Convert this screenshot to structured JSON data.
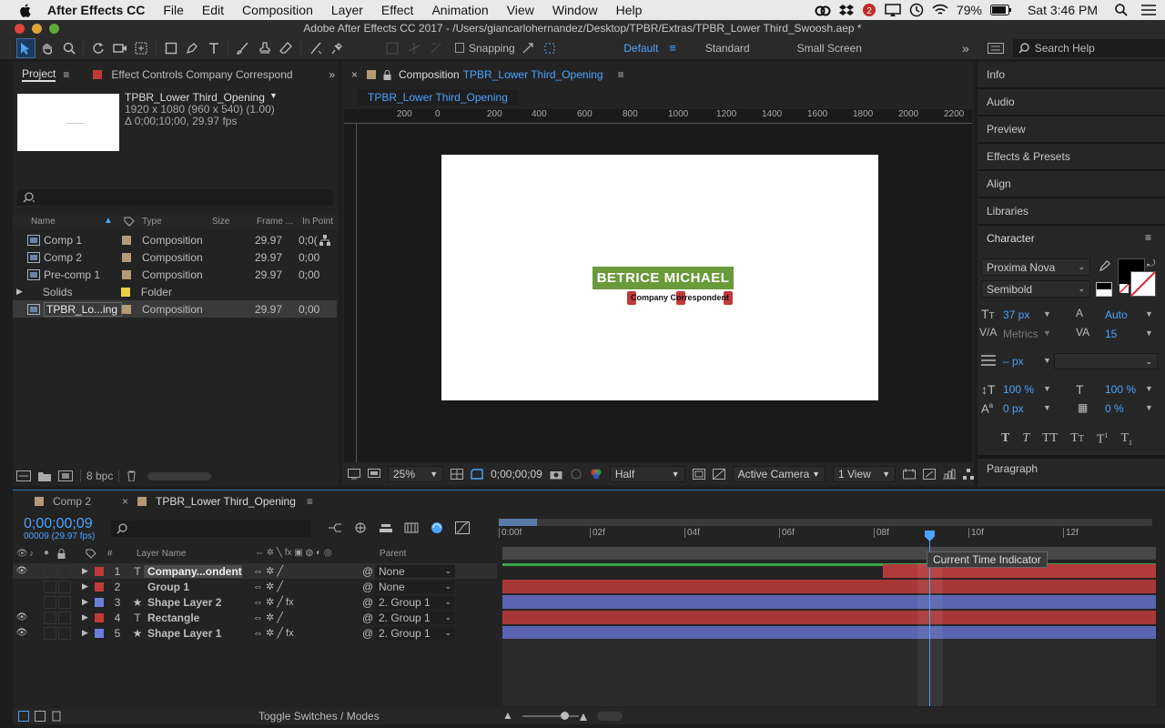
{
  "menubar": {
    "app": "After Effects CC",
    "items": [
      "File",
      "Edit",
      "Composition",
      "Layer",
      "Effect",
      "Animation",
      "View",
      "Window",
      "Help"
    ],
    "battery": "79%",
    "clock": "Sat 3:46 PM"
  },
  "window": {
    "title": "Adobe After Effects CC 2017 - /Users/giancarlohernandez/Desktop/TPBR/Extras/TPBR_Lower Third_Swoosh.aep *"
  },
  "toolbar": {
    "snapping_label": "Snapping",
    "workspaces": [
      "Default",
      "Standard",
      "Small Screen"
    ],
    "active_workspace": "Default",
    "search_help_placeholder": "Search Help"
  },
  "project_panel": {
    "tab_project": "Project",
    "tab_effect_controls": "Effect Controls Company Correspond",
    "selected_item_name": "TPBR_Lower Third_Opening",
    "selected_item_dims": "1920 x 1080  (960 x 540) (1.00)",
    "selected_item_duration": "Δ 0;00;10;00, 29.97 fps",
    "columns": [
      "Name",
      "Type",
      "Size",
      "Frame ...",
      "In Point"
    ],
    "rows": [
      {
        "name": "Comp 1",
        "label_color": "#b49a78",
        "type": "Composition",
        "size": "",
        "frame": "29.97",
        "in_point": "0;0("
      },
      {
        "name": "Comp 2",
        "label_color": "#b49a78",
        "type": "Composition",
        "size": "",
        "frame": "29.97",
        "in_point": "0;00"
      },
      {
        "name": "Pre-comp 1",
        "label_color": "#b49a78",
        "type": "Composition",
        "size": "",
        "frame": "29.97",
        "in_point": "0;00"
      },
      {
        "name": "Solids",
        "label_color": "#e8d244",
        "type": "Folder",
        "size": "",
        "frame": "",
        "in_point": ""
      },
      {
        "name": "TPBR_Lo...ing",
        "label_color": "#b49a78",
        "type": "Composition",
        "size": "",
        "frame": "29.97",
        "in_point": "0;00"
      }
    ],
    "bpc": "8 bpc"
  },
  "composition_panel": {
    "tab_label": "Composition",
    "tab_comp_name": "TPBR_Lower Third_Opening",
    "breadcrumb": "TPBR_Lower Third_Opening",
    "ruler_labels": [
      "200",
      "0",
      "200",
      "400",
      "600",
      "800",
      "1000",
      "1200",
      "1400",
      "1600",
      "1800",
      "2000",
      "2200"
    ],
    "lower_third_name": "BETRICE MICHAEL",
    "lower_third_subtitle": "Company Correspondent",
    "zoom": "25%",
    "timecode": "0;00;00;09",
    "resolution": "Half",
    "camera": "Active Camera",
    "views": "1 View"
  },
  "right_panel": {
    "items": [
      "Info",
      "Audio",
      "Preview",
      "Effects & Presets",
      "Align",
      "Libraries"
    ],
    "character_title": "Character",
    "font_family": "Proxima Nova",
    "font_style": "Semibold",
    "font_size": "37 px",
    "leading": "Auto",
    "kerning": "Metrics",
    "tracking": "15",
    "stroke_width": "– px",
    "vertical_scale": "100 %",
    "horizontal_scale": "100 %",
    "baseline_shift": "0 px",
    "tsume": "0 %",
    "paragraph_title": "Paragraph"
  },
  "timeline": {
    "tabs": [
      "Comp 2",
      "TPBR_Lower Third_Opening"
    ],
    "timecode": "0;00;00;09",
    "fps_label": "00009 (29.97 fps)",
    "time_markers": [
      "0:00f",
      "02f",
      "04f",
      "06f",
      "08f",
      "10f",
      "12f"
    ],
    "column_headers": {
      "number": "#",
      "layer_name": "Layer Name",
      "parent": "Parent"
    },
    "tooltip": "Current Time Indicator",
    "layers": [
      {
        "num": "1",
        "type_icon": "T",
        "name": "Company...ondent",
        "label_color": "#c03a3a",
        "parent": "None",
        "bar_color": "#b33a3a",
        "visible": true
      },
      {
        "num": "2",
        "type_icon": "",
        "name": "Group 1",
        "label_color": "#c03a3a",
        "parent": "None",
        "bar_color": "#a83838",
        "visible": false
      },
      {
        "num": "3",
        "type_icon": "★",
        "name": "Shape Layer 2",
        "label_color": "#6b7fd8",
        "parent": "2. Group 1",
        "bar_color": "#5a64b0",
        "visible": false
      },
      {
        "num": "4",
        "type_icon": "T",
        "name": "Rectangle",
        "label_color": "#c03a3a",
        "parent": "2. Group 1",
        "bar_color": "#a83838",
        "visible": true
      },
      {
        "num": "5",
        "type_icon": "★",
        "name": "Shape Layer 1",
        "label_color": "#6b7fd8",
        "parent": "2. Group 1",
        "bar_color": "#5a64b0",
        "visible": true
      }
    ],
    "toggle_label": "Toggle Switches / Modes"
  }
}
